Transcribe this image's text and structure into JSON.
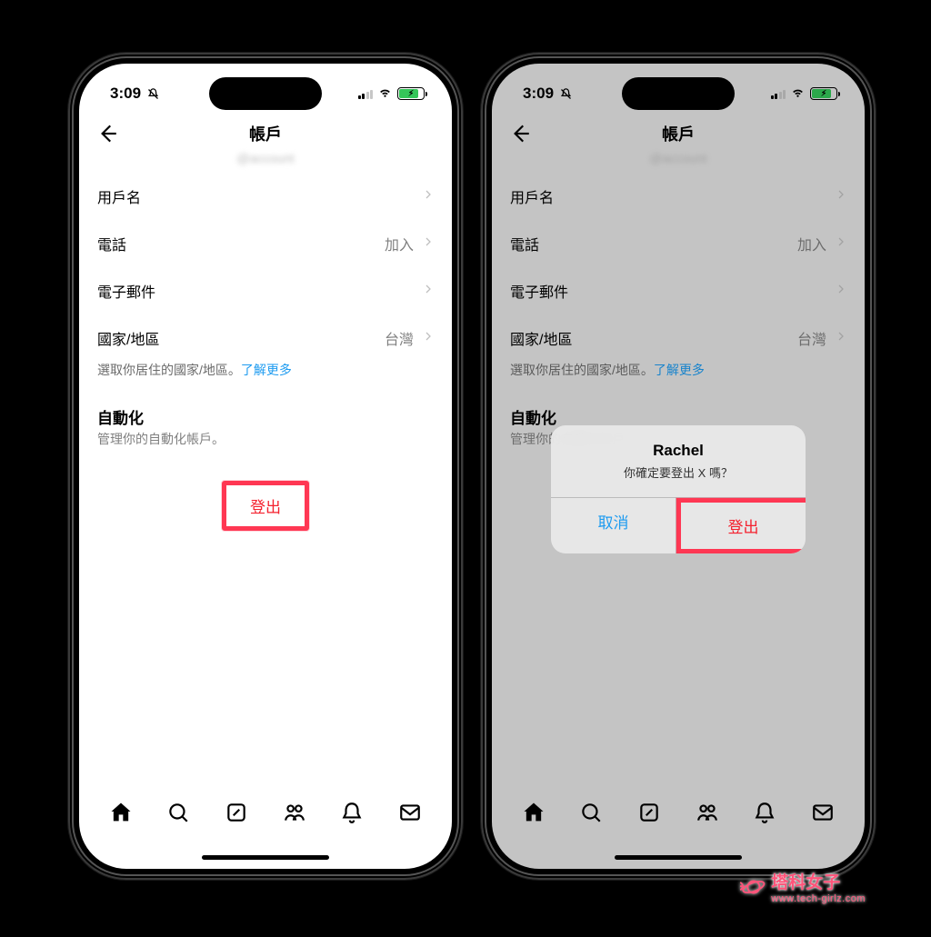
{
  "status": {
    "time": "3:09"
  },
  "header": {
    "title": "帳戶",
    "subtitle_blurred": "@account"
  },
  "rows": {
    "username": {
      "label": "用戶名",
      "value_blurred": ""
    },
    "phone": {
      "label": "電話",
      "value": "加入"
    },
    "email": {
      "label": "電子郵件",
      "value_blurred": ""
    },
    "country": {
      "label": "國家/地區",
      "value": "台灣"
    }
  },
  "country_hint": {
    "text": "選取你居住的國家/地區。",
    "link": "了解更多"
  },
  "automation": {
    "title": "自動化",
    "subtitle": "管理你的自動化帳戶。"
  },
  "logout": {
    "label": "登出"
  },
  "alert": {
    "title": "Rachel",
    "message": "你確定要登出 X 嗎？",
    "cancel": "取消",
    "confirm": "登出"
  },
  "watermark": {
    "name": "塔科女子",
    "url": "www.tech-girlz.com"
  }
}
